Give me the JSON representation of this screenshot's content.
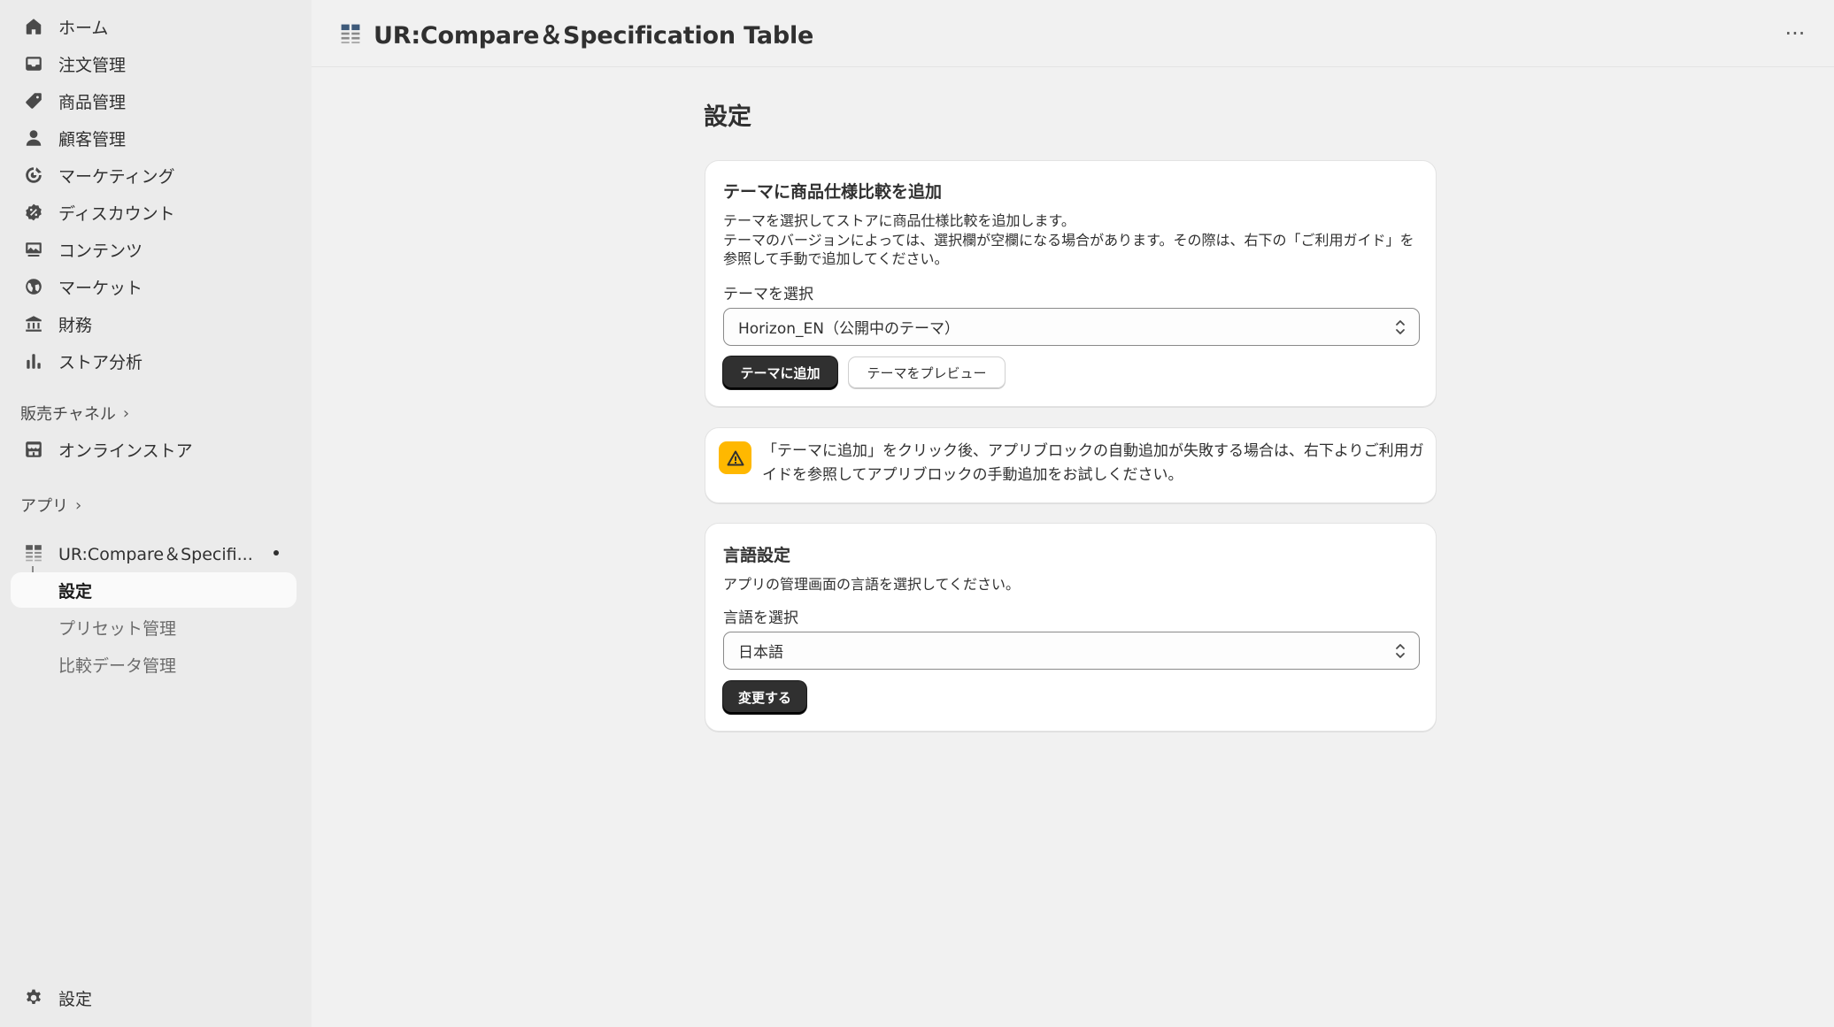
{
  "sidebar": {
    "items": [
      {
        "label": "ホーム",
        "icon": "home-icon"
      },
      {
        "label": "注文管理",
        "icon": "inbox-icon"
      },
      {
        "label": "商品管理",
        "icon": "tag-icon"
      },
      {
        "label": "顧客管理",
        "icon": "person-icon"
      },
      {
        "label": "マーケティング",
        "icon": "target-icon"
      },
      {
        "label": "ディスカウント",
        "icon": "discount-icon"
      },
      {
        "label": "コンテンツ",
        "icon": "content-icon"
      },
      {
        "label": "マーケット",
        "icon": "globe-icon"
      },
      {
        "label": "財務",
        "icon": "bank-icon"
      },
      {
        "label": "ストア分析",
        "icon": "chart-icon"
      }
    ],
    "sales_channels_label": "販売チャネル",
    "online_store_label": "オンラインストア",
    "apps_label": "アプリ",
    "app_name": "UR:Compare＆Specifi...",
    "app_sub_items": [
      "設定",
      "プリセット管理",
      "比較データ管理"
    ],
    "settings_label": "設定"
  },
  "header": {
    "title": "UR:Compare＆Specification Table",
    "more": "···"
  },
  "main": {
    "page_title": "設定",
    "theme_card": {
      "title": "テーマに商品仕様比較を追加",
      "description_1": "テーマを選択してストアに商品仕様比較を追加します。",
      "description_2": "テーマのバージョンによっては、選択欄が空欄になる場合があります。その際は、右下の「ご利用ガイド」を参照して手動で追加してください。",
      "select_label": "テーマを選択",
      "select_value": "Horizon_EN（公開中のテーマ）",
      "add_button": "テーマに追加",
      "preview_button": "テーマをプレビュー"
    },
    "warning": {
      "text": "「テーマに追加」をクリック後、アプリブロックの自動追加が失敗する場合は、右下よりご利用ガイドを参照してアプリブロックの手動追加をお試しください。",
      "color": "#ffb800"
    },
    "language_card": {
      "title": "言語設定",
      "description": "アプリの管理画面の言語を選択してください。",
      "select_label": "言語を選択",
      "select_value": "日本語",
      "change_button": "変更する"
    }
  }
}
